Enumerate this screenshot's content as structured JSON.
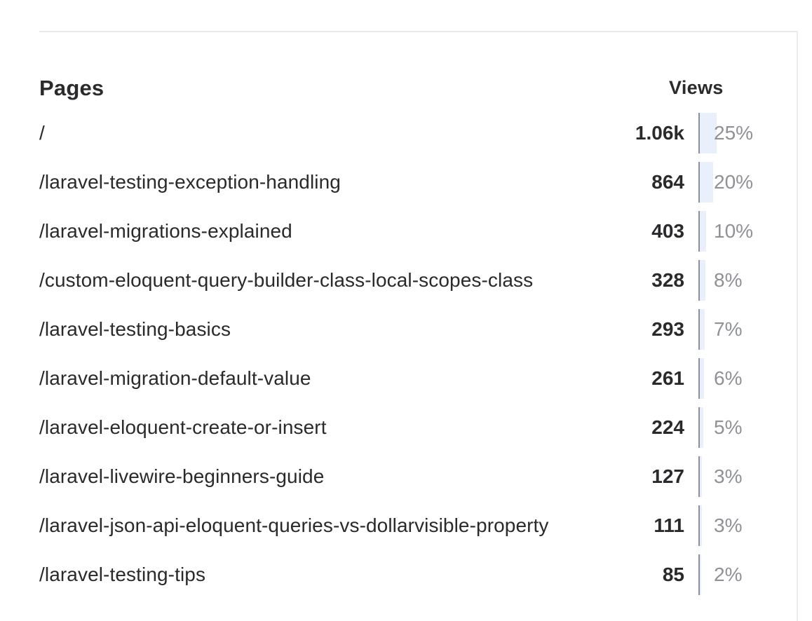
{
  "table": {
    "header_pages": "Pages",
    "header_views": "Views",
    "rows": [
      {
        "path": "/",
        "views": "1.06k",
        "percent": "25%",
        "share": 25
      },
      {
        "path": "/laravel-testing-exception-handling",
        "views": "864",
        "percent": "20%",
        "share": 20
      },
      {
        "path": "/laravel-migrations-explained",
        "views": "403",
        "percent": "10%",
        "share": 10
      },
      {
        "path": "/custom-eloquent-query-builder-class-local-scopes-class",
        "views": "328",
        "percent": "8%",
        "share": 8
      },
      {
        "path": "/laravel-testing-basics",
        "views": "293",
        "percent": "7%",
        "share": 7
      },
      {
        "path": "/laravel-migration-default-value",
        "views": "261",
        "percent": "6%",
        "share": 6
      },
      {
        "path": "/laravel-eloquent-create-or-insert",
        "views": "224",
        "percent": "5%",
        "share": 5
      },
      {
        "path": "/laravel-livewire-beginners-guide",
        "views": "127",
        "percent": "3%",
        "share": 3
      },
      {
        "path": "/laravel-json-api-eloquent-queries-vs-dollarvisible-property",
        "views": "111",
        "percent": "3%",
        "share": 3
      },
      {
        "path": "/laravel-testing-tips",
        "views": "85",
        "percent": "2%",
        "share": 2
      }
    ]
  },
  "colors": {
    "bar_fill": "#eaf0fb",
    "bar_axis": "#8a8f99",
    "percent_text": "#8f9196",
    "text": "#2a2a2c"
  }
}
